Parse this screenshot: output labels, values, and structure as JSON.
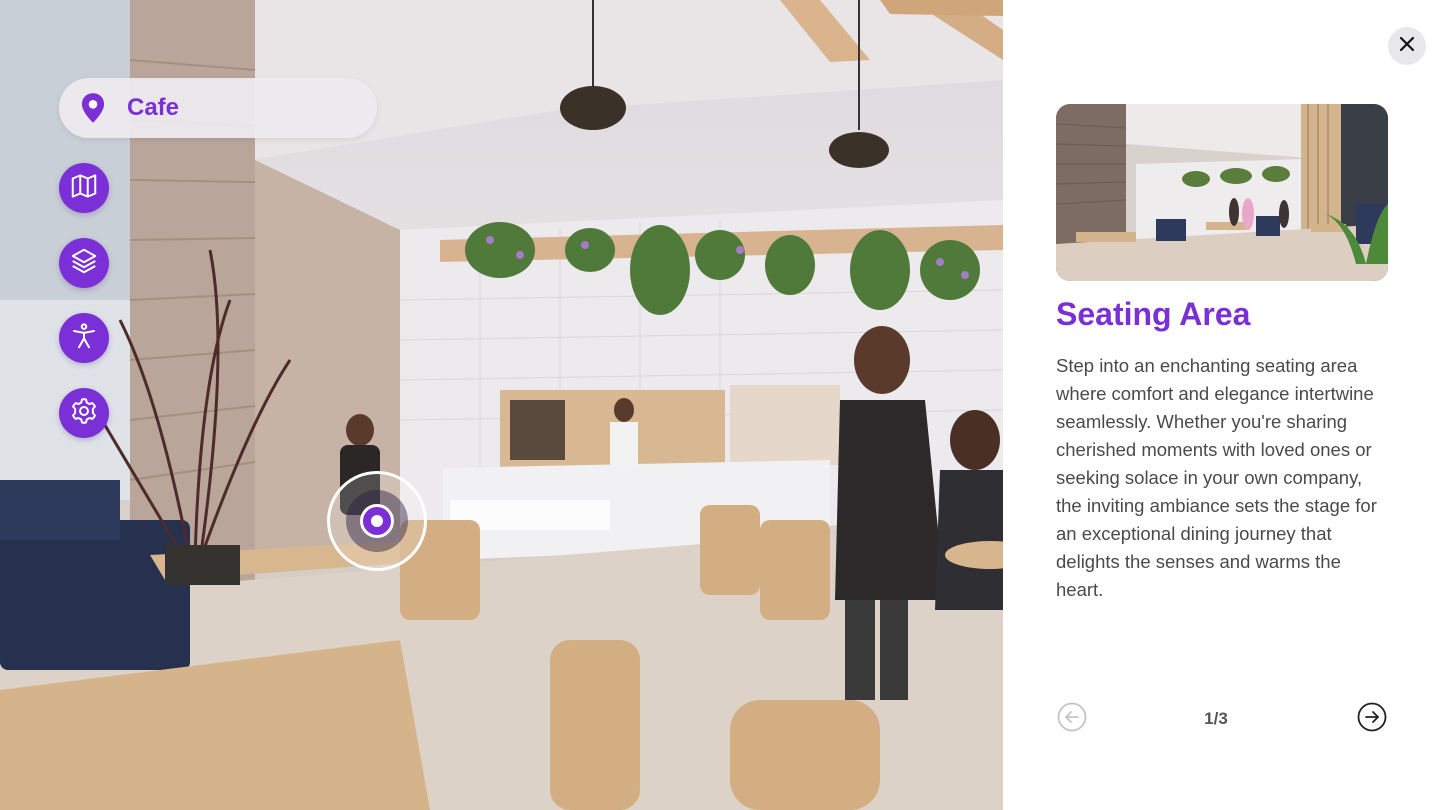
{
  "location": {
    "label": "Cafe",
    "icon": "map-pin-icon"
  },
  "side_buttons": [
    {
      "name": "map",
      "icon": "map-icon"
    },
    {
      "name": "layers",
      "icon": "layers-icon"
    },
    {
      "name": "accessibility",
      "icon": "accessibility-icon"
    },
    {
      "name": "settings",
      "icon": "gear-icon"
    }
  ],
  "panel": {
    "title": "Seating Area",
    "description": "Step into an enchanting seating area where comfort and elegance intertwine seamlessly. Whether you're sharing cherished moments with loved ones or seeking solace in your own company, the inviting ambiance sets the stage for an exceptional dining journey that delights the senses and warms the heart.",
    "pager": "1/3"
  },
  "colors": {
    "accent": "#7b2fd6",
    "text": "#4a4a4a",
    "pill_bg": "#eeecf0"
  }
}
